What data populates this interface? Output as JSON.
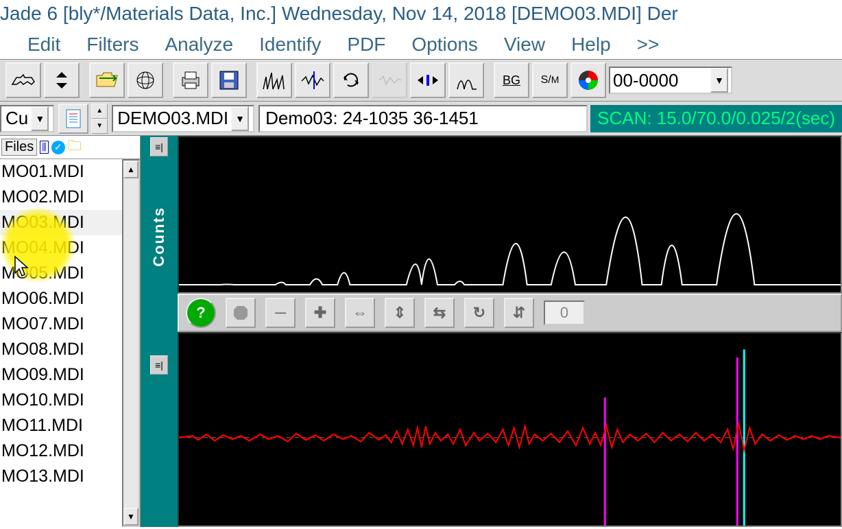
{
  "title": "Jade 6 [bly*/Materials Data, Inc.] Wednesday, Nov 14, 2018 [DEMO03.MDI] Der",
  "menu": [
    "Edit",
    "Filters",
    "Analyze",
    "Identify",
    "PDF",
    "Options",
    "View",
    "Help",
    ">>"
  ],
  "toolbar": {
    "pdf_code": "00-0000"
  },
  "second": {
    "anode": "Cu",
    "file": "DEMO03.MDI",
    "desc": "Demo03: 24-1035 36-1451",
    "scan": "SCAN: 15.0/70.0/0.025/2(sec)"
  },
  "side": {
    "tab": "Files",
    "files": [
      "MO01.MDI",
      "MO02.MDI",
      "MO03.MDI",
      "MO04.MDI",
      "MO05.MDI",
      "MO06.MDI",
      "MO07.MDI",
      "MO08.MDI",
      "MO09.MDI",
      "MO10.MDI",
      "MO11.MDI",
      "MO12.MDI",
      "MO13.MDI"
    ]
  },
  "plot": {
    "ylabel": "Counts",
    "mid_counter": "0"
  },
  "chart_data": [
    {
      "type": "line",
      "name": "diffraction-pattern",
      "ylabel": "Counts",
      "xrange": [
        15.0,
        70.0
      ],
      "peaks_x": [
        26.5,
        29,
        31.5,
        38,
        41.5,
        44.5,
        47,
        50.5,
        56,
        59
      ],
      "peaks_rel_intensity": [
        0.05,
        0.1,
        0.15,
        0.28,
        0.35,
        0.05,
        0.55,
        0.45,
        0.95,
        0.55,
        1.0
      ]
    },
    {
      "type": "line",
      "name": "difference-plot",
      "baseline": 0,
      "markers_x": [
        47,
        56,
        59
      ],
      "markers_color": [
        "magenta",
        "magenta",
        "cyan"
      ]
    }
  ]
}
